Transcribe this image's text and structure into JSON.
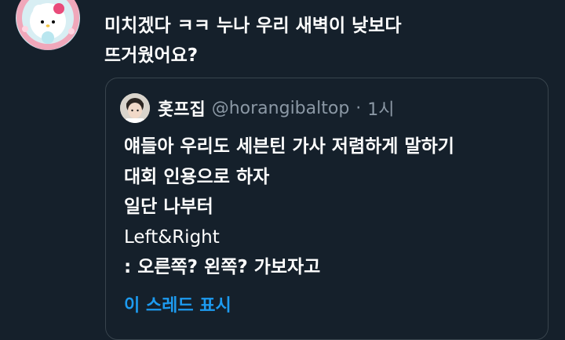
{
  "tweet": {
    "lines": [
      "미치겠다 ㅋㅋ 누나 우리 새벽이 낮보다",
      "뜨거웠어요?"
    ]
  },
  "quote": {
    "display_name": "홋프집",
    "handle": "@horangibaltop",
    "dot": "·",
    "time": "1시",
    "lines": [
      "얘들아 우리도 세븐틴 가사 저렴하게 말하기",
      "대회 인용으로 하자",
      "일단 나부터",
      "Left&Right",
      ": 오른쪽? 왼쪽? 가보자고"
    ],
    "show_thread_label": "이 스레드 표시"
  },
  "colors": {
    "background": "#15202b",
    "border": "#38444d",
    "secondary_text": "#8b98a5",
    "accent": "#1d9bf0"
  },
  "icons": {
    "user_avatar": "hello-kitty-avatar",
    "quote_avatar": "person-avatar"
  }
}
